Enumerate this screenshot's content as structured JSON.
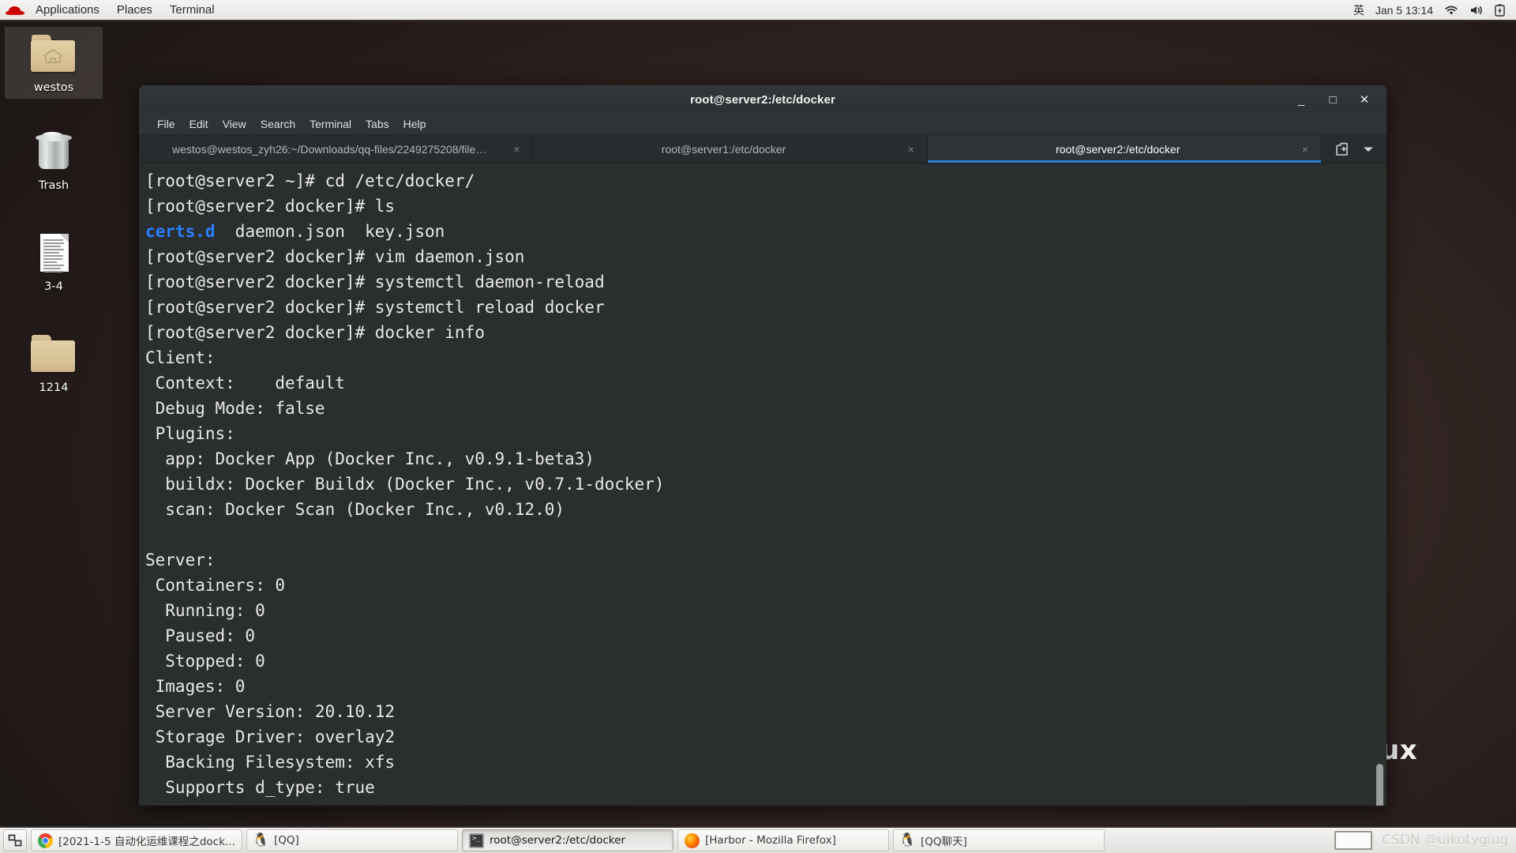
{
  "top_panel": {
    "logo": "redhat-logo",
    "menus": [
      "Applications",
      "Places",
      "Terminal"
    ],
    "ime": "英",
    "clock": "Jan 5  13:14",
    "indicators": [
      "wifi-icon",
      "volume-icon",
      "battery-icon"
    ]
  },
  "desktop": {
    "wallpaper_text": "ux",
    "icons": [
      {
        "label": "westos",
        "icon": "home-folder-icon",
        "selected": true
      },
      {
        "label": "Trash",
        "icon": "trash-icon",
        "selected": false
      },
      {
        "label": "3-4",
        "icon": "document-icon",
        "selected": false
      },
      {
        "label": "1214",
        "icon": "folder-icon",
        "selected": false
      }
    ]
  },
  "terminal_window": {
    "title": "root@server2:/etc/docker",
    "window_buttons": {
      "minimize": "_",
      "maximize": "□",
      "close": "✕"
    },
    "menus": [
      "File",
      "Edit",
      "View",
      "Search",
      "Terminal",
      "Tabs",
      "Help"
    ],
    "tabs": [
      {
        "title": "westos@westos_zyh26:~/Downloads/qq-files/2249275208/file…",
        "active": false,
        "close": "×"
      },
      {
        "title": "root@server1:/etc/docker",
        "active": false,
        "close": "×"
      },
      {
        "title": "root@server2:/etc/docker",
        "active": true,
        "close": "×"
      }
    ],
    "tab_actions": [
      "new-tab-icon",
      "tab-list-dropdown-icon"
    ],
    "content_lines": [
      {
        "text": "[root@server2 ~]# cd /etc/docker/"
      },
      {
        "text": "[root@server2 docker]# ls"
      },
      {
        "segments": [
          {
            "text": "certs.d",
            "color": "#2a7fff"
          },
          {
            "text": "  daemon.json  key.json"
          }
        ]
      },
      {
        "text": "[root@server2 docker]# vim daemon.json"
      },
      {
        "text": "[root@server2 docker]# systemctl daemon-reload"
      },
      {
        "text": "[root@server2 docker]# systemctl reload docker"
      },
      {
        "text": "[root@server2 docker]# docker info"
      },
      {
        "text": "Client:"
      },
      {
        "text": " Context:    default"
      },
      {
        "text": " Debug Mode: false"
      },
      {
        "text": " Plugins:"
      },
      {
        "text": "  app: Docker App (Docker Inc., v0.9.1-beta3)"
      },
      {
        "text": "  buildx: Docker Buildx (Docker Inc., v0.7.1-docker)"
      },
      {
        "text": "  scan: Docker Scan (Docker Inc., v0.12.0)"
      },
      {
        "text": ""
      },
      {
        "text": "Server:"
      },
      {
        "text": " Containers: 0"
      },
      {
        "text": "  Running: 0"
      },
      {
        "text": "  Paused: 0"
      },
      {
        "text": "  Stopped: 0"
      },
      {
        "text": " Images: 0"
      },
      {
        "text": " Server Version: 20.10.12"
      },
      {
        "text": " Storage Driver: overlay2"
      },
      {
        "text": "  Backing Filesystem: xfs"
      },
      {
        "text": "  Supports d_type: true"
      }
    ]
  },
  "taskbar": {
    "show_desktop": "show-desktop-icon",
    "items": [
      {
        "label": "[2021-1-5 自动化运维课程之docker…",
        "icon": "chrome-icon",
        "active": false
      },
      {
        "label": "[QQ]",
        "icon": "qq-icon",
        "active": false
      },
      {
        "label": "root@server2:/etc/docker",
        "icon": "terminal-icon",
        "active": true
      },
      {
        "label": "[Harbor - Mozilla Firefox]",
        "icon": "firefox-icon",
        "active": false
      },
      {
        "label": "[QQ聊天]",
        "icon": "qq-icon",
        "active": false
      }
    ],
    "watermark": "CSDN @uikotygiug"
  },
  "colors": {
    "accent_tab": "#2a7fd4",
    "terminal_bg": "#2a2e2e",
    "titlebar_bg": "#2e3436",
    "dir_blue": "#2a7fff",
    "panel_bg": "#eeedeb"
  }
}
